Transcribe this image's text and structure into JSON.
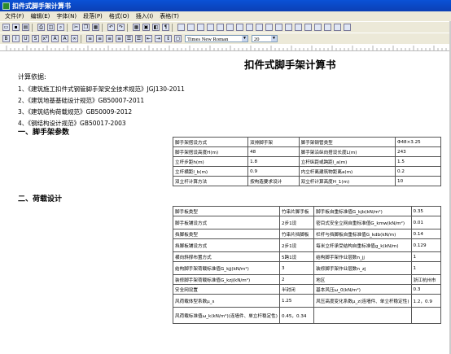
{
  "window": {
    "title": "扣件式脚手架计算书"
  },
  "menu": [
    "文件(F)",
    "编辑(E)",
    "字体(N)",
    "段落(P)",
    "格式(O)",
    "插入(I)",
    "表格(T)"
  ],
  "toolbar": {
    "font_name": "Times New Roman",
    "font_size": "20"
  },
  "document": {
    "title": "扣件式脚手架计算书",
    "basis_label": "计算依据:",
    "basis": [
      "1、《建筑施工扣件式钢管脚手架安全技术规范》JGJ130-2011",
      "2、《建筑地基基础设计规范》GB50007-2011",
      "3、《建筑结构荷载规范》GB50009-2012",
      "4、《钢结构设计规范》GB50017-2003"
    ],
    "section1": "一、脚手架参数",
    "section2": "二、荷载设计",
    "table1": [
      [
        "脚手架搭设方式",
        "双排脚手架",
        "脚手架钢管类型",
        "Φ48×3.25"
      ],
      [
        "脚手架搭设高度H(m)",
        "48",
        "脚手架沿纵向搭设长度L(m)",
        "243"
      ],
      [
        "立杆步距h(m)",
        "1.8",
        "立杆纵距或跨距l_a(m)",
        "1.5"
      ],
      [
        "立杆横距l_b(m)",
        "0.9",
        "内立杆离建筑物距离a(m)",
        "0.2"
      ],
      [
        "双立杆计算方法",
        "按构造要求设计",
        "双立杆计算高度H_1(m)",
        "10"
      ]
    ],
    "table2": [
      [
        "脚手板类型",
        "竹串片脚手板",
        "脚手板自重标准值G_kjb(kN/m²)",
        "0.35"
      ],
      [
        "脚手板铺设方式",
        "2步1设",
        "密目式安全立网自重标准值G_kmw(kN/m²)",
        "0.01"
      ],
      [
        "挡脚板类型",
        "竹串片挡脚板",
        "栏杆与挡脚板自重标准值G_kdb(kN/m)",
        "0.14"
      ],
      [
        "挡脚板铺设方式",
        "2步1设",
        "每米立杆承受结构自重标准值g_k(kN/m)",
        "0.129"
      ],
      [
        "横向斜撑布置方式",
        "5跨1设",
        "结构脚手架作业层数n_jj",
        "1"
      ],
      [
        "结构脚手架荷载标准值G_kjj(kN/m²)",
        "3",
        "装修脚手架作业层数n_zj",
        "1"
      ],
      [
        "装修脚手架荷载标准值G_kzj(kN/m²)",
        "2",
        "地区",
        "浙江杭州市"
      ],
      [
        "安全网设置",
        "半封闭",
        "基本风压ω_0(kN/m²)",
        "0.3"
      ],
      [
        "风荷载体型系数μ_s",
        "1.25",
        "风压高度变化系数μ_z(连墙件、单立杆稳定性)",
        "1.2，0.9"
      ],
      [
        "风荷载标准值ω_k(kN/m²)(连墙件、单立杆稳定性)",
        "0.45，0.34",
        "",
        ""
      ]
    ]
  }
}
